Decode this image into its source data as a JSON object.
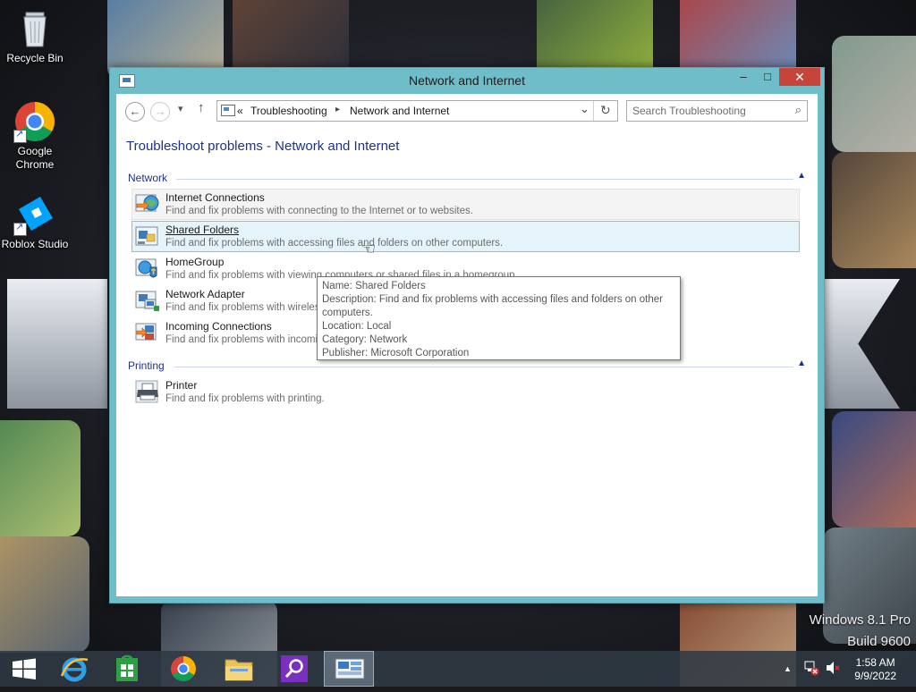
{
  "desktop": {
    "icons": [
      {
        "label": "Recycle Bin",
        "icon": "recycle-bin-icon"
      },
      {
        "label": "Google Chrome",
        "label_line1": "Google",
        "label_line2": "Chrome",
        "icon": "chrome-icon"
      },
      {
        "label": "Roblox Studio",
        "icon": "roblox-studio-icon"
      }
    ],
    "watermark": {
      "line1": "Windows 8.1 Pro",
      "line2": "Build 9600"
    }
  },
  "window": {
    "title": "Network and Internet",
    "controls": {
      "minimize": "–",
      "maximize": "□",
      "close": "✕"
    },
    "navigation": {
      "back": "←",
      "forward": "→",
      "recent": "▾",
      "up": "↑",
      "breadcrumb_overflow": "«",
      "breadcrumb": [
        "Troubleshooting",
        "Network and Internet"
      ],
      "dropdown": "⌄",
      "refresh": "↻"
    },
    "search": {
      "placeholder": "Search Troubleshooting",
      "icon": "⌕"
    },
    "page_title": "Troubleshoot problems - Network and Internet",
    "groups": [
      {
        "name": "Network",
        "items": [
          {
            "name": "Internet Connections",
            "description": "Find and fix problems with connecting to the Internet or to websites.",
            "icon": "internet-connections-icon"
          },
          {
            "name": "Shared Folders",
            "description": "Find and fix problems with accessing files and folders on other computers.",
            "icon": "shared-folders-icon"
          },
          {
            "name": "HomeGroup",
            "description": "Find and fix problems with viewing computers or shared files in a homegroup.",
            "icon": "homegroup-icon"
          },
          {
            "name": "Network Adapter",
            "description": "Find and fix problems with wireless and other network adapters.",
            "icon": "network-adapter-icon"
          },
          {
            "name": "Incoming Connections",
            "description": "Find and fix problems with incoming computer connections and Windows Firewall.",
            "icon": "incoming-connections-icon"
          }
        ]
      },
      {
        "name": "Printing",
        "items": [
          {
            "name": "Printer",
            "description": "Find and fix problems with printing.",
            "icon": "printer-icon"
          }
        ]
      }
    ],
    "tooltip": {
      "name": "Name: Shared Folders",
      "description_line1": "Description: Find and fix problems with accessing files and folders on other",
      "description_line2": "computers.",
      "location": "Location: Local",
      "category": "Category: Network",
      "publisher": "Publisher: Microsoft Corporation"
    }
  },
  "taskbar": {
    "items": [
      {
        "name": "start",
        "icon": "windows-logo-icon"
      },
      {
        "name": "internet-explorer",
        "icon": "internet-explorer-icon"
      },
      {
        "name": "store",
        "icon": "store-icon"
      },
      {
        "name": "chrome",
        "icon": "chrome-icon"
      },
      {
        "name": "file-explorer",
        "icon": "folder-icon"
      },
      {
        "name": "search",
        "icon": "search-app-icon"
      },
      {
        "name": "control-panel",
        "icon": "control-panel-icon",
        "active": true
      }
    ],
    "tray": {
      "show_hidden": "▲",
      "network_status": "network-error",
      "volume_status": "muted"
    },
    "clock": {
      "time": "1:58 AM",
      "date": "9/9/2022"
    }
  },
  "colors": {
    "window_frame": "#6fbdc9",
    "close_button": "#c7443a",
    "heading_blue": "#1e3287",
    "hover_fill": "#e5f3fb",
    "hover_border": "#7ec6e6"
  }
}
